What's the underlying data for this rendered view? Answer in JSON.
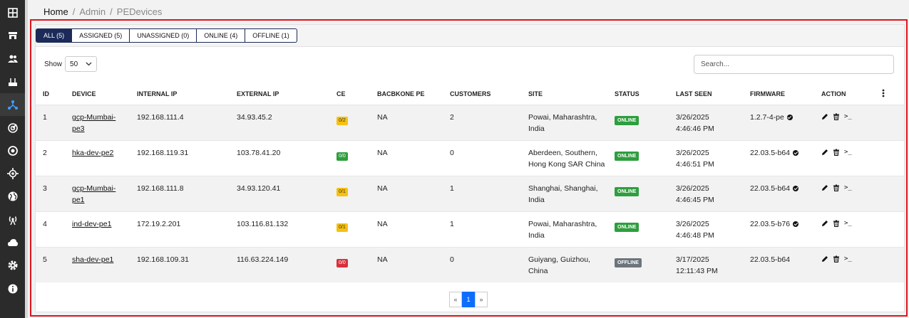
{
  "breadcrumb": {
    "home": "Home",
    "sep1": "/",
    "admin": "Admin",
    "sep2": "/",
    "current": "PEDevices"
  },
  "sidebar": {
    "icons": [
      "dashboard-icon",
      "store-icon",
      "users-icon",
      "router-icon",
      "network-icon",
      "radar-icon",
      "target-icon",
      "crosshair-icon",
      "globe-icon",
      "antenna-icon",
      "cloud-icon",
      "settings-icon",
      "info-icon"
    ],
    "active_index": 4,
    "bg_color": "#2b2b2b"
  },
  "tabs": [
    {
      "label": "ALL (5)",
      "active": true
    },
    {
      "label": "ASSIGNED (5)",
      "active": false
    },
    {
      "label": "UNASSIGNED (0)",
      "active": false
    },
    {
      "label": "ONLINE (4)",
      "active": false
    },
    {
      "label": "OFFLINE (1)",
      "active": false
    }
  ],
  "show": {
    "label": "Show",
    "value": "50"
  },
  "search": {
    "placeholder": "Search..."
  },
  "columns": [
    "ID",
    "DEVICE",
    "INTERNAL IP",
    "EXTERNAL IP",
    "CE",
    "BACBKONE PE",
    "CUSTOMERS",
    "SITE",
    "STATUS",
    "LAST SEEN",
    "FIRMWARE",
    "ACTION"
  ],
  "rows": [
    {
      "id": "1",
      "device": [
        "gcp-Mumbai-",
        "pe3"
      ],
      "internal_ip": "192.168.111.4",
      "external_ip": "34.93.45.2",
      "ce": "0/2",
      "ce_color": "y",
      "backbone": "NA",
      "customers": "2",
      "site": [
        "Powai, Maharashtra,",
        "India"
      ],
      "status": "ONLINE",
      "last_seen": [
        "3/26/2025",
        "4:46:46 PM"
      ],
      "firmware": "1.2.7-4-pe",
      "verified": true
    },
    {
      "id": "2",
      "device": [
        "hka-dev-pe2"
      ],
      "internal_ip": "192.168.119.31",
      "external_ip": "103.78.41.20",
      "ce": "0/0",
      "ce_color": "g",
      "backbone": "NA",
      "customers": "0",
      "site": [
        "Aberdeen, Southern,",
        "Hong Kong SAR China"
      ],
      "status": "ONLINE",
      "last_seen": [
        "3/26/2025",
        "4:46:51 PM"
      ],
      "firmware": "22.03.5-b64",
      "verified": true
    },
    {
      "id": "3",
      "device": [
        "gcp-Mumbai-",
        "pe1"
      ],
      "internal_ip": "192.168.111.8",
      "external_ip": "34.93.120.41",
      "ce": "0/1",
      "ce_color": "y",
      "backbone": "NA",
      "customers": "1",
      "site": [
        "Shanghai, Shanghai,",
        "India"
      ],
      "status": "ONLINE",
      "last_seen": [
        "3/26/2025",
        "4:46:45 PM"
      ],
      "firmware": "22.03.5-b64",
      "verified": true
    },
    {
      "id": "4",
      "device": [
        "ind-dev-pe1"
      ],
      "internal_ip": "172.19.2.201",
      "external_ip": "103.116.81.132",
      "ce": "0/1",
      "ce_color": "y",
      "backbone": "NA",
      "customers": "1",
      "site": [
        "Powai, Maharashtra,",
        "India"
      ],
      "status": "ONLINE",
      "last_seen": [
        "3/26/2025",
        "4:46:48 PM"
      ],
      "firmware": "22.03.5-b76",
      "verified": true
    },
    {
      "id": "5",
      "device": [
        "sha-dev-pe1"
      ],
      "internal_ip": "192.168.109.31",
      "external_ip": "116.63.224.149",
      "ce": "0/0",
      "ce_color": "r",
      "backbone": "NA",
      "customers": "0",
      "site": [
        "Guiyang, Guizhou,",
        "China"
      ],
      "status": "OFFLINE",
      "last_seen": [
        "3/17/2025",
        "12:11:43 PM"
      ],
      "firmware": "22.03.5-b64",
      "verified": false
    }
  ],
  "action_terminal": ">_",
  "pagination": {
    "prev": "«",
    "current": "1",
    "next": "»"
  },
  "colors": {
    "accent_navy": "#1b2a59",
    "online": "#2e9e3e",
    "offline": "#6c757d",
    "frame_red": "#e0141e",
    "page_blue": "#0d6efd"
  }
}
